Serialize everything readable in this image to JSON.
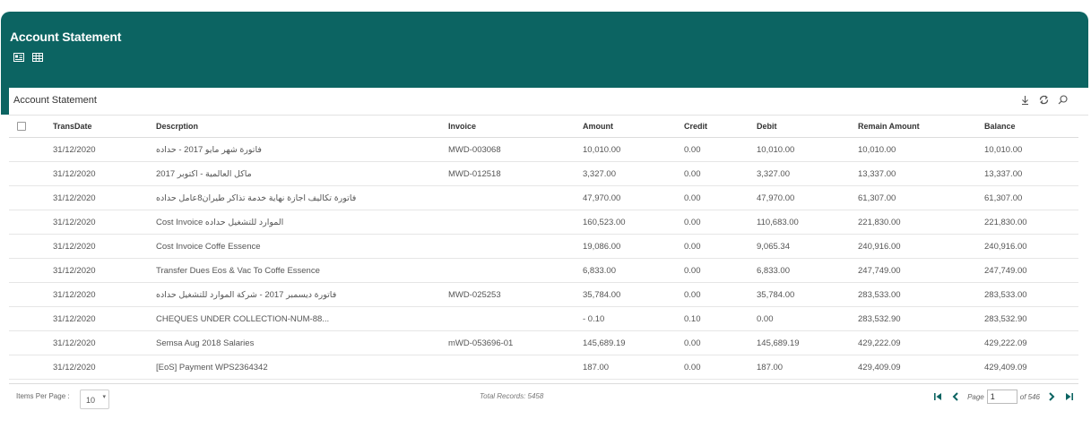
{
  "header": {
    "title": "Account Statement"
  },
  "panel": {
    "title": "Account Statement"
  },
  "table": {
    "columns": [
      "TransDate",
      "Descrption",
      "Invoice",
      "Amount",
      "Credit",
      "Debit",
      "Remain Amount",
      "Balance"
    ],
    "rows": [
      [
        "31/12/2020",
        "فاتورة شهر مايو 2017 - حداده",
        "MWD-003068",
        "10,010.00",
        "0.00",
        "10,010.00",
        "10,010.00",
        "10,010.00"
      ],
      [
        "31/12/2020",
        "ماكل العالمية - اكتوبر 2017",
        "MWD-012518",
        "3,327.00",
        "0.00",
        "3,327.00",
        "13,337.00",
        "13,337.00"
      ],
      [
        "31/12/2020",
        "فاتورة تكاليف اجازة نهاية خدمة تذاكر طيران8عامل حداده",
        "",
        "47,970.00",
        "0.00",
        "47,970.00",
        "61,307.00",
        "61,307.00"
      ],
      [
        "31/12/2020",
        "Cost Invoice الموارد للتشغيل حداده",
        "",
        "160,523.00",
        "0.00",
        "110,683.00",
        "221,830.00",
        "221,830.00"
      ],
      [
        "31/12/2020",
        "Cost Invoice Coffe Essence",
        "",
        "19,086.00",
        "0.00",
        "9,065.34",
        "240,916.00",
        "240,916.00"
      ],
      [
        "31/12/2020",
        "Transfer Dues Eos & Vac To Coffe Essence",
        "",
        "6,833.00",
        "0.00",
        "6,833.00",
        "247,749.00",
        "247,749.00"
      ],
      [
        "31/12/2020",
        "فاتورة ديسمبر 2017 - شركة الموارد للتشغيل حداده",
        "MWD-025253",
        "35,784.00",
        "0.00",
        "35,784.00",
        "283,533.00",
        "283,533.00"
      ],
      [
        "31/12/2020",
        "CHEQUES UNDER COLLECTION-NUM-88...",
        "",
        "- 0.10",
        "0.10",
        "0.00",
        "283,532.90",
        "283,532.90"
      ],
      [
        "31/12/2020",
        "Semsa Aug 2018 Salaries",
        "mWD-053696-01",
        "145,689.19",
        "0.00",
        "145,689.19",
        "429,222.09",
        "429,222.09"
      ],
      [
        "31/12/2020",
        "[EoS] Payment WPS2364342",
        "",
        "187.00",
        "0.00",
        "187.00",
        "429,409.09",
        "429,409.09"
      ]
    ]
  },
  "footer": {
    "items_per_page_label": "Items Per Page :",
    "items_per_page_value": "10",
    "total_records": "Total Records: 5458",
    "page_label": "Page",
    "page_value": "1",
    "of_label": "of 546"
  },
  "colors": {
    "header_bg": "#0c6462",
    "pager_accent": "#0c6462"
  },
  "icons": [
    "card-view-icon",
    "grid-view-icon",
    "download-icon",
    "refresh-icon",
    "search-icon",
    "first-page-icon",
    "previous-page-icon",
    "next-page-icon",
    "last-page-icon"
  ]
}
